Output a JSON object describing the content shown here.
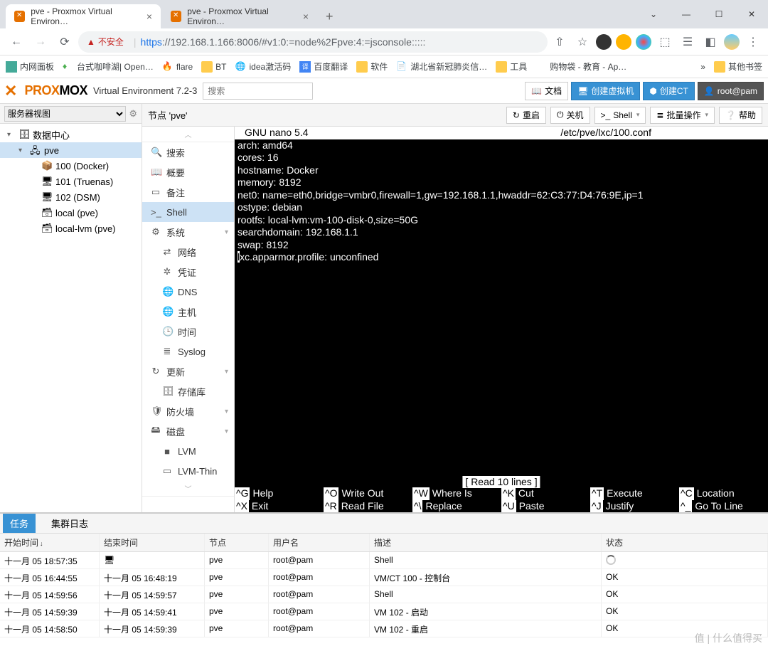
{
  "browser": {
    "tabs": [
      {
        "title": "pve - Proxmox Virtual Environ…",
        "active": true
      },
      {
        "title": "pve - Proxmox Virtual Environ…",
        "active": false
      }
    ],
    "url_warning": "不安全",
    "url": "https://192.168.1.166:8006/#v1:0:=node%2Fpve:4:=jsconsole:::::",
    "bookmarks": [
      {
        "label": "内网面板",
        "icon": "grid"
      },
      {
        "label": "台式咖啡湖| Open…",
        "icon": "drop"
      },
      {
        "label": "flare",
        "icon": "flame"
      },
      {
        "label": "BT",
        "icon": "folder"
      },
      {
        "label": "idea激活码",
        "icon": "globe"
      },
      {
        "label": "百度翻译",
        "icon": "translate"
      },
      {
        "label": "软件",
        "icon": "folder"
      },
      {
        "label": "湖北省新冠肺炎信…",
        "icon": "doc"
      },
      {
        "label": "工具",
        "icon": "folder"
      },
      {
        "label": "购物袋 - 教育 - Ap…",
        "icon": "apple"
      }
    ],
    "bookmarks_more": "»",
    "bookmarks_other": "其他书签"
  },
  "header": {
    "brand_a": "PROX",
    "brand_b": "MOX",
    "version": "Virtual Environment 7.2-3",
    "search_placeholder": "搜索",
    "buttons": {
      "docs": "文档",
      "create_vm": "创建虚拟机",
      "create_ct": "创建CT",
      "user": "root@pam"
    }
  },
  "sidebar": {
    "view_label": "服务器视图",
    "tree": [
      {
        "label": "数据中心",
        "level": 0,
        "icon": "server",
        "expanded": true
      },
      {
        "label": "pve",
        "level": 1,
        "icon": "node",
        "expanded": true,
        "selected": true
      },
      {
        "label": "100 (Docker)",
        "level": 2,
        "icon": "ct-run"
      },
      {
        "label": "101 (Truenas)",
        "level": 2,
        "icon": "vm"
      },
      {
        "label": "102 (DSM)",
        "level": 2,
        "icon": "vm"
      },
      {
        "label": "local (pve)",
        "level": 2,
        "icon": "storage"
      },
      {
        "label": "local-lvm (pve)",
        "level": 2,
        "icon": "storage"
      }
    ]
  },
  "content": {
    "title": "节点 'pve'",
    "toolbar": {
      "reboot": "重启",
      "shutdown": "关机",
      "shell": "Shell",
      "bulk": "批量操作",
      "help": "帮助"
    },
    "menu": [
      {
        "label": "搜索",
        "icon": "🔍"
      },
      {
        "label": "概要",
        "icon": "📖"
      },
      {
        "label": "备注",
        "icon": "▭"
      },
      {
        "label": "Shell",
        "icon": ">_",
        "active": true
      },
      {
        "label": "系统",
        "icon": "⚙",
        "expand": true
      },
      {
        "label": "网络",
        "icon": "⇄",
        "sub": true
      },
      {
        "label": "凭证",
        "icon": "✲",
        "sub": true
      },
      {
        "label": "DNS",
        "icon": "🌐",
        "sub": true
      },
      {
        "label": "主机",
        "icon": "🌐",
        "sub": true
      },
      {
        "label": "时间",
        "icon": "🕒",
        "sub": true
      },
      {
        "label": "Syslog",
        "icon": "≣",
        "sub": true
      },
      {
        "label": "更新",
        "icon": "↻",
        "expand": true
      },
      {
        "label": "存储库",
        "icon": "🗄",
        "sub": true
      },
      {
        "label": "防火墙",
        "icon": "🛡",
        "expand": true
      },
      {
        "label": "磁盘",
        "icon": "🖴",
        "expand": true
      },
      {
        "label": "LVM",
        "icon": "■",
        "sub": true
      },
      {
        "label": "LVM-Thin",
        "icon": "▭",
        "sub": true
      }
    ]
  },
  "terminal": {
    "editor": "GNU nano 5.4",
    "filepath": "/etc/pve/lxc/100.conf",
    "lines": [
      "arch: amd64",
      "cores: 16",
      "hostname: Docker",
      "memory: 8192",
      "net0: name=eth0,bridge=vmbr0,firewall=1,gw=192.168.1.1,hwaddr=62:C3:77:D4:76:9E,ip=1",
      "ostype: debian",
      "rootfs: local-lvm:vm-100-disk-0,size=50G",
      "searchdomain: 192.168.1.1",
      "swap: 8192"
    ],
    "cursor_line_prefix": "l",
    "cursor_line_rest": "xc.apparmor.profile: unconfined",
    "status": "[ Read 10 lines ]",
    "footer": [
      {
        "k": "^G",
        "l": "Help"
      },
      {
        "k": "^O",
        "l": "Write Out"
      },
      {
        "k": "^W",
        "l": "Where Is"
      },
      {
        "k": "^K",
        "l": "Cut"
      },
      {
        "k": "^T",
        "l": "Execute"
      },
      {
        "k": "^C",
        "l": "Location"
      },
      {
        "k": "^X",
        "l": "Exit"
      },
      {
        "k": "^R",
        "l": "Read File"
      },
      {
        "k": "^\\",
        "l": "Replace"
      },
      {
        "k": "^U",
        "l": "Paste"
      },
      {
        "k": "^J",
        "l": "Justify"
      },
      {
        "k": "^_",
        "l": "Go To Line"
      }
    ]
  },
  "bottom": {
    "tabs": {
      "tasks": "任务",
      "cluster_log": "集群日志"
    },
    "columns": {
      "start": "开始时间",
      "end": "结束时间",
      "node": "节点",
      "user": "用户名",
      "desc": "描述",
      "status": "状态"
    },
    "rows": [
      {
        "start": "十一月 05 18:57:35",
        "end": "",
        "end_icon": true,
        "node": "pve",
        "user": "root@pam",
        "desc": "Shell",
        "status": "",
        "spinner": true
      },
      {
        "start": "十一月 05 16:44:55",
        "end": "十一月 05 16:48:19",
        "node": "pve",
        "user": "root@pam",
        "desc": "VM/CT 100 - 控制台",
        "status": "OK"
      },
      {
        "start": "十一月 05 14:59:56",
        "end": "十一月 05 14:59:57",
        "node": "pve",
        "user": "root@pam",
        "desc": "Shell",
        "status": "OK"
      },
      {
        "start": "十一月 05 14:59:39",
        "end": "十一月 05 14:59:41",
        "node": "pve",
        "user": "root@pam",
        "desc": "VM 102 - 启动",
        "status": "OK"
      },
      {
        "start": "十一月 05 14:58:50",
        "end": "十一月 05 14:59:39",
        "node": "pve",
        "user": "root@pam",
        "desc": "VM 102 - 重启",
        "status": "OK"
      }
    ]
  },
  "watermark": "值 | 什么值得买"
}
